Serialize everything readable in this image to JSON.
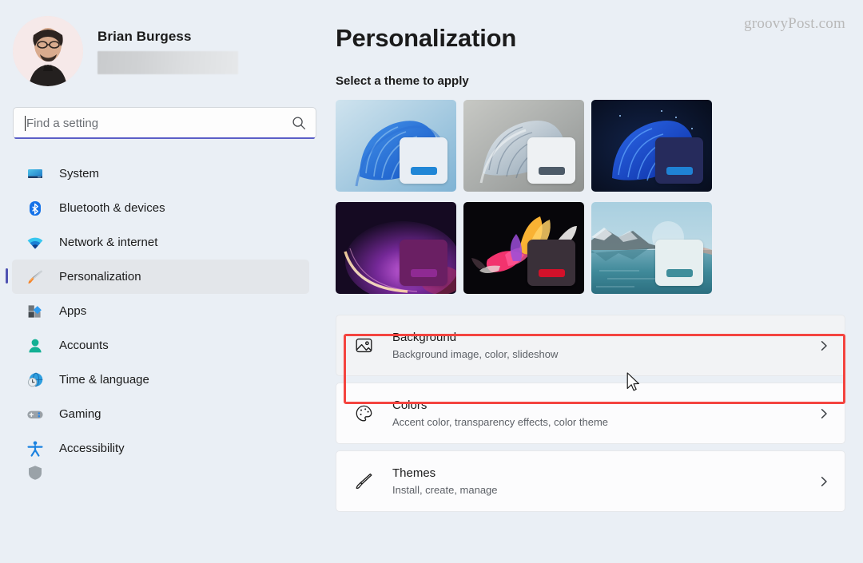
{
  "watermark": "groovyPost.com",
  "profile": {
    "name": "Brian Burgess",
    "email_hidden": ""
  },
  "search": {
    "placeholder": "Find a setting",
    "icon": "search-icon"
  },
  "sidebar": {
    "items": [
      {
        "label": "System",
        "icon": "monitor-icon",
        "selected": false
      },
      {
        "label": "Bluetooth & devices",
        "icon": "bluetooth-icon",
        "selected": false
      },
      {
        "label": "Network & internet",
        "icon": "wifi-icon",
        "selected": false
      },
      {
        "label": "Personalization",
        "icon": "paintbrush-icon",
        "selected": true
      },
      {
        "label": "Apps",
        "icon": "apps-icon",
        "selected": false
      },
      {
        "label": "Accounts",
        "icon": "person-icon",
        "selected": false
      },
      {
        "label": "Time & language",
        "icon": "globe-clock-icon",
        "selected": false
      },
      {
        "label": "Gaming",
        "icon": "gamepad-icon",
        "selected": false
      },
      {
        "label": "Accessibility",
        "icon": "accessibility-icon",
        "selected": false
      },
      {
        "label": "",
        "icon": "shield-icon",
        "selected": false
      }
    ]
  },
  "main": {
    "title": "Personalization",
    "theme_section_label": "Select a theme to apply",
    "themes": [
      {
        "name": "windows-light-bloom",
        "bg": "linear-gradient(135deg,#bfd8e6 0%,#9fc4dc 45%,#7fb0d2 100%)",
        "card_bg": "#e9eef4",
        "accent": "#2086d6",
        "art": "bloom-blue"
      },
      {
        "name": "windows-grey-bloom",
        "bg": "linear-gradient(135deg,#b9bbb8 0%,#a6a9a6 50%,#8f918f 100%)",
        "card_bg": "#eef1f3",
        "accent": "#4d5b68",
        "art": "bloom-grey"
      },
      {
        "name": "windows-dark-bloom",
        "bg": "linear-gradient(135deg,#0b1324 0%,#0d1b33 55%,#081020 100%)",
        "card_bg": "#262b5c",
        "accent": "#1f82d4",
        "art": "bloom-darkblue"
      },
      {
        "name": "glow-purple",
        "bg": "linear-gradient(150deg,#1b1030 0%,#3c1552 45%,#2a1038 100%)",
        "card_bg": "#6a1f63",
        "accent": "#8f2a93",
        "art": "glow-purple"
      },
      {
        "name": "flow-flower",
        "bg": "#07060a",
        "card_bg": "#3a3039",
        "accent": "#d2112a",
        "art": "flower"
      },
      {
        "name": "landscape-water",
        "bg": "linear-gradient(180deg,#b5d5e2 0%,#9fc8d8 40%,#4d8d9e 100%)",
        "card_bg": "#e6eff0",
        "accent": "#3f8e9b",
        "art": "landscape"
      }
    ],
    "settings_rows": [
      {
        "title": "Background",
        "subtitle": "Background image, color, slideshow",
        "icon": "image-icon",
        "chevron": "chevron-right-icon",
        "highlighted": true,
        "hover": true
      },
      {
        "title": "Colors",
        "subtitle": "Accent color, transparency effects, color theme",
        "icon": "palette-icon",
        "chevron": "chevron-right-icon",
        "highlighted": false,
        "hover": false
      },
      {
        "title": "Themes",
        "subtitle": "Install, create, manage",
        "icon": "brush-icon",
        "chevron": "chevron-right-icon",
        "highlighted": false,
        "hover": false
      }
    ]
  },
  "annotations": {
    "highlight_color": "#f4443f",
    "cursor": "arrow-pointer"
  }
}
